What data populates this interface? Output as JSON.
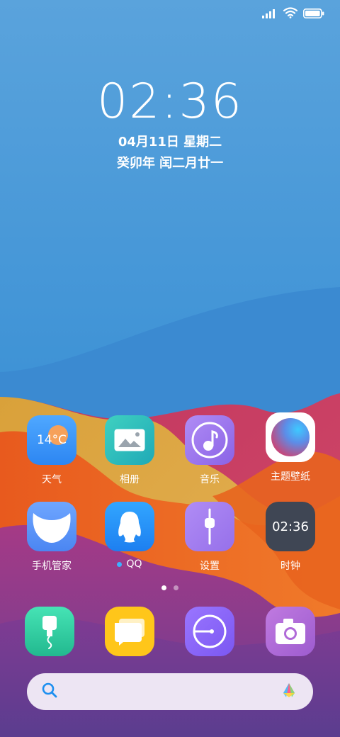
{
  "status_bar": {
    "signal_icon": "signal-bars-icon",
    "wifi_icon": "wifi-icon",
    "battery_icon": "battery-icon",
    "battery_level": 1.0
  },
  "lock_clock": {
    "time": "02:36",
    "date": "04月11日 星期二",
    "lunar": "癸卯年 闰二月廿一"
  },
  "apps": {
    "weather": {
      "label": "天气",
      "temp": "14°C"
    },
    "gallery": {
      "label": "相册"
    },
    "music": {
      "label": "音乐"
    },
    "themes": {
      "label": "主题壁纸"
    },
    "security": {
      "label": "手机管家"
    },
    "qq": {
      "label": "QQ"
    },
    "settings": {
      "label": "设置"
    },
    "clock": {
      "label": "时钟",
      "time": "02:36"
    }
  },
  "dock": {
    "phone": {
      "icon": "phone-icon"
    },
    "messages": {
      "icon": "messages-icon"
    },
    "browser": {
      "icon": "browser-icon"
    },
    "camera": {
      "icon": "camera-icon"
    }
  },
  "pager": {
    "pages": 2,
    "current": 1
  },
  "search_bar": {
    "search_icon": "search-icon",
    "assistant_icon": "assistant-logo-icon"
  },
  "colors": {
    "accent_blue": "#1d8ff0",
    "qq_dot": "#3cb0ff"
  }
}
